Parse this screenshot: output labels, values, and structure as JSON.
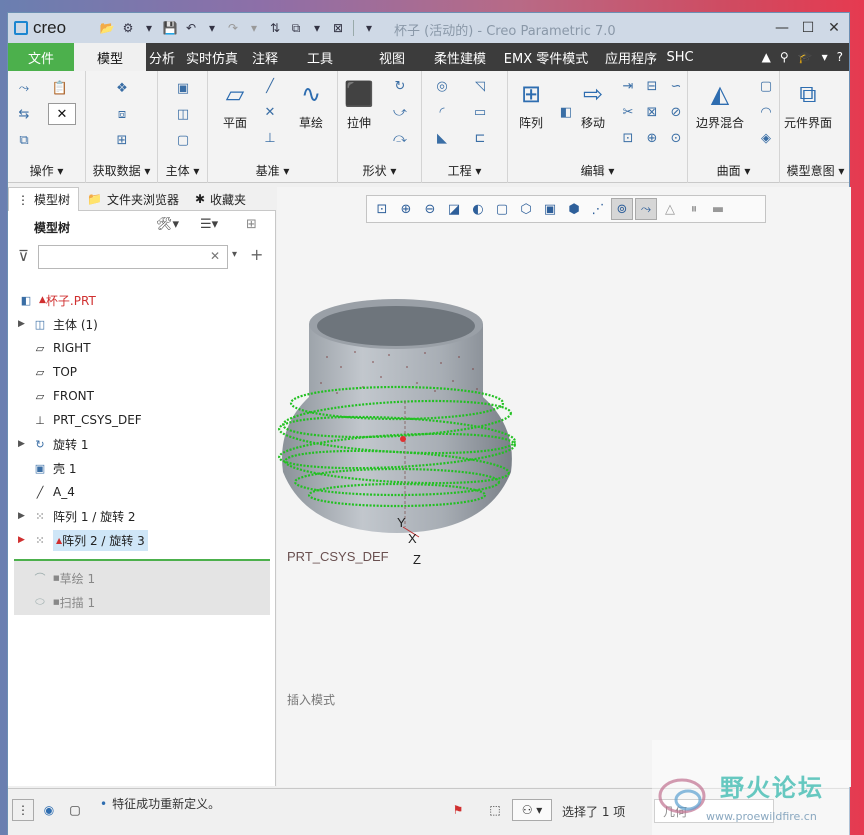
{
  "app": {
    "logo": "creo",
    "window_title": "杯子 (活动的) - Creo Parametric 7.0"
  },
  "window_controls": {
    "minimize": "—",
    "maximize": "☐",
    "close": "✕"
  },
  "menu": {
    "tabs": [
      "文件",
      "模型",
      "分析",
      "实时仿真",
      "注释",
      "工具",
      "视图",
      "柔性建模",
      "EMX 零件模式",
      "应用程序",
      "SHC"
    ],
    "active": "模型"
  },
  "ribbon": {
    "groups": {
      "operations": "操作",
      "get_data": "获取数据",
      "body": "主体",
      "datum": "基准",
      "shape": "形状",
      "engineering": "工程",
      "editing": "编辑",
      "surfaces": "曲面",
      "model_intent": "模型意图"
    },
    "buttons": {
      "plane": "平面",
      "sketch": "草绘",
      "extrude": "拉伸",
      "pattern": "阵列",
      "move": "移动",
      "boundary_blend": "边界混合",
      "component_interface": "元件界面"
    }
  },
  "nav_tabs": [
    "模型树",
    "文件夹浏览器",
    "收藏夹"
  ],
  "model_tree": {
    "title": "模型树",
    "filter_placeholder": "",
    "root": "杯子.PRT",
    "items": [
      {
        "label": "主体 (1)"
      },
      {
        "label": "RIGHT"
      },
      {
        "label": "TOP"
      },
      {
        "label": "FRONT"
      },
      {
        "label": "PRT_CSYS_DEF"
      },
      {
        "label": "旋转 1"
      },
      {
        "label": "壳 1"
      },
      {
        "label": "A_4"
      },
      {
        "label": "阵列 1 / 旋转 2"
      },
      {
        "label": "阵列 2 / 旋转 3"
      }
    ],
    "after_insert": [
      {
        "label": "草绘 1"
      },
      {
        "label": "扫描 1"
      }
    ]
  },
  "viewport": {
    "csys_label": "PRT_CSYS_DEF",
    "axis_y": "Y",
    "axis_x": "X",
    "axis_z": "Z",
    "mode_text": "插入模式"
  },
  "status": {
    "message": "特征成功重新定义。",
    "selection": "选择了 1 项",
    "filter_value": "几何"
  },
  "watermark": {
    "text": "野火论坛",
    "url": "www.proewildfire.cn"
  },
  "colors": {
    "file_tab": "#4cb04c",
    "menubar": "#3c3c3c",
    "highlight": "#cfe6f7",
    "pattern_green": "#22c022",
    "warning_red": "#d03030"
  }
}
